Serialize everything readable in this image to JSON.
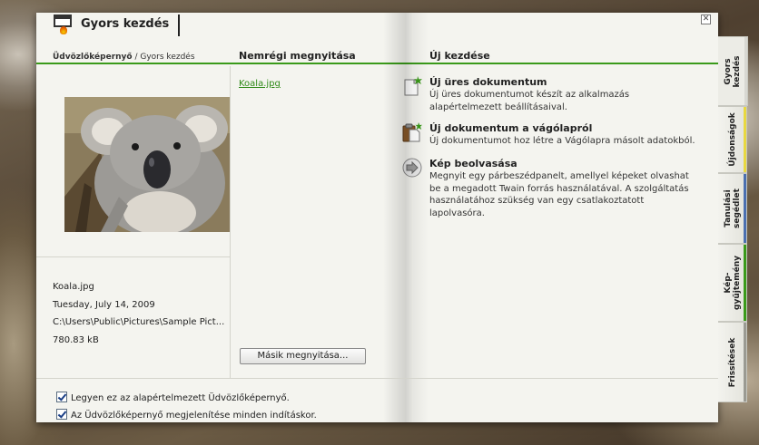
{
  "window": {
    "title": "Gyors kezdés",
    "close_glyph": "✕"
  },
  "breadcrumb": {
    "home": "Üdvözlőképernyő",
    "separator": " / ",
    "current": "Gyors kezdés"
  },
  "columns": {
    "recent_heading": "Nemrégi megnyitása",
    "new_heading": "Új kezdése"
  },
  "selected_file": {
    "name": "Koala.jpg",
    "date": "Tuesday, July 14, 2009",
    "path": "C:\\Users\\Public\\Pictures\\Sample Pict...",
    "size": "780.83 kB"
  },
  "recent": {
    "items": [
      "Koala.jpg"
    ],
    "other_button": "Másik megnyitása..."
  },
  "actions": [
    {
      "icon": "new-document-icon",
      "title": "Új üres dokumentum",
      "desc": "Új üres dokumentumot készít az alkalmazás alapértelmezett beállításaival."
    },
    {
      "icon": "clipboard-document-icon",
      "title": "Új dokumentum a vágólapról",
      "desc": "Új dokumentumot hoz létre a Vágólapra másolt adatokból."
    },
    {
      "icon": "scan-icon",
      "title": "Kép beolvasása",
      "desc": "Megnyit egy párbeszédpanelt, amellyel képeket olvashat be a megadott Twain forrás használatával. A szolgáltatás használatához szükség van egy csatlakoztatott lapolvasóra."
    }
  ],
  "footer": {
    "checkbox1": "Legyen ez az alapértelmezett Üdvözlőképernyő.",
    "checkbox2": "Az Üdvözlőképernyő megjelenítése minden indításkor."
  },
  "tabs": [
    {
      "label_line1": "Gyors",
      "label_line2": "kezdés",
      "color": "#d8d8d2",
      "active": true
    },
    {
      "label_line1": "Újdonságok",
      "label_line2": "",
      "color": "#e8d840"
    },
    {
      "label_line1": "Tanulási",
      "label_line2": "segédlet",
      "color": "#4a6fb0"
    },
    {
      "label_line1": "Kép-",
      "label_line2": "gyűjtemény",
      "color": "#3a9a1a"
    },
    {
      "label_line1": "Frissítések",
      "label_line2": "",
      "color": "#9a9a92"
    }
  ],
  "colors": {
    "accent": "#3a9a1a",
    "link": "#2f8a18"
  }
}
